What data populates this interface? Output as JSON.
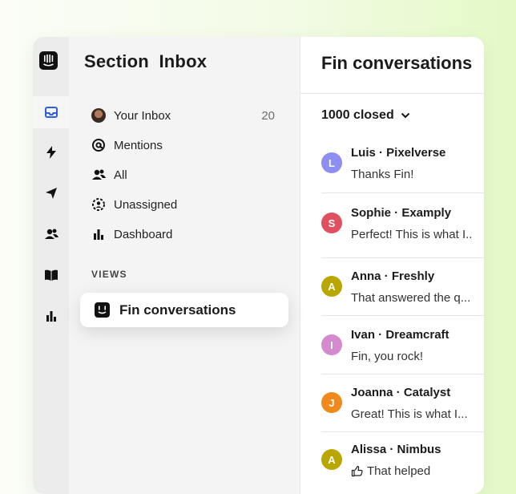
{
  "sidebar": {
    "title": "Section  Inbox",
    "items": [
      {
        "label": "Your Inbox",
        "count": "20",
        "icon": "avatar"
      },
      {
        "label": "Mentions",
        "icon": "at-icon"
      },
      {
        "label": "All",
        "icon": "users-icon"
      },
      {
        "label": "Unassigned",
        "icon": "unassigned-icon"
      },
      {
        "label": "Dashboard",
        "icon": "bar-chart-icon"
      }
    ],
    "views_heading": "VIEWS",
    "selected_view": "Fin conversations"
  },
  "rail": {
    "icons": [
      "intercom-logo-icon",
      "inbox-icon",
      "lightning-icon",
      "send-icon",
      "contacts-icon",
      "book-icon",
      "reports-icon"
    ]
  },
  "main": {
    "title": "Fin conversations",
    "filter_label": "1000 closed",
    "conversations": [
      {
        "initial": "L",
        "color": "#8c8ff0",
        "name": "Luis · Pixelverse",
        "message": "Thanks Fin!"
      },
      {
        "initial": "S",
        "color": "#e0505f",
        "name": "Sophie · Examply",
        "message": "Perfect! This is what I.."
      },
      {
        "initial": "A",
        "color": "#b9a600",
        "name": "Anna · Freshly",
        "message": "That answered the q..."
      },
      {
        "initial": "I",
        "color": "#d58ad0",
        "name": "Ivan · Dreamcraft",
        "message": "Fin, you rock!"
      },
      {
        "initial": "J",
        "color": "#f08a1c",
        "name": "Joanna · Catalyst",
        "message": "Great! This is what I..."
      },
      {
        "initial": "A",
        "color": "#b9a600",
        "name": "Alissa · Nimbus",
        "message": "That helped"
      }
    ]
  }
}
